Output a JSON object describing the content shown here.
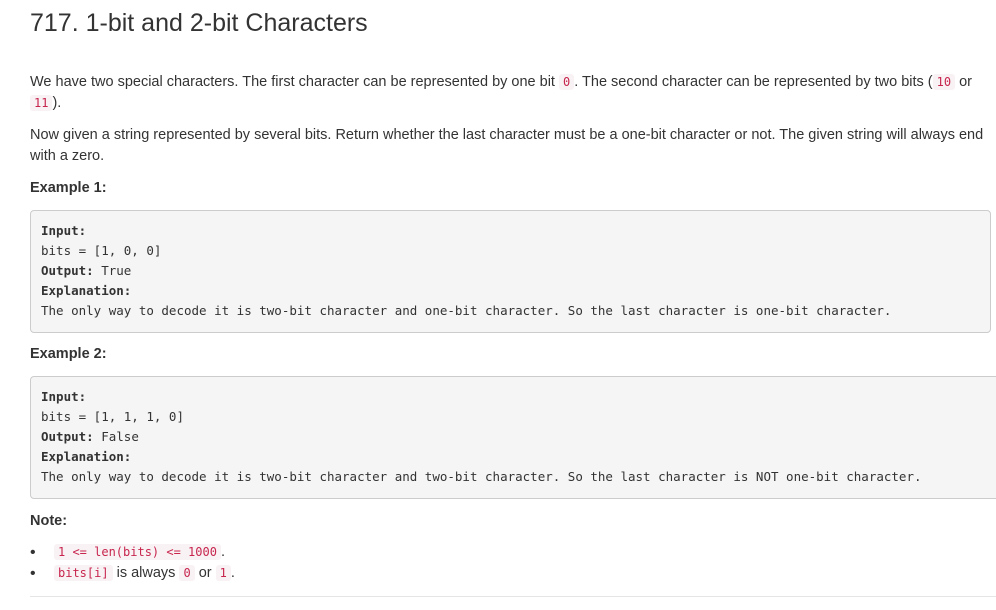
{
  "problem": {
    "title": "717. 1-bit and 2-bit Characters"
  },
  "para1": {
    "t1": "We have two special characters. The first character can be represented by one bit ",
    "c1": "0",
    "t2": ". The second character can be represented by two bits (",
    "c2": "10",
    "t3": " or ",
    "c3": "11",
    "t4": ")."
  },
  "para2": {
    "text": "Now given a string represented by several bits. Return whether the last character must be a one-bit character or not. The given string will always end with a zero."
  },
  "example1": {
    "label": "Example 1:",
    "input_label": "Input:",
    "input_value": "bits = [1, 0, 0]",
    "output_label": "Output:",
    "output_value": " True",
    "explanation_label": "Explanation:",
    "explanation_text": "The only way to decode it is two-bit character and one-bit character. So the last character is one-bit character."
  },
  "example2": {
    "label": "Example 2:",
    "input_label": "Input:",
    "input_value": "bits = [1, 1, 1, 0]",
    "output_label": "Output:",
    "output_value": " False",
    "explanation_label": "Explanation:",
    "explanation_text": "The only way to decode it is two-bit character and two-bit character. So the last character is NOT one-bit character."
  },
  "note": {
    "label": "Note:",
    "bullet": "•",
    "item1": {
      "code": "1 <= len(bits) <= 1000",
      "tail": "."
    },
    "item2": {
      "code1": "bits[i]",
      "t1": " is always ",
      "code2": "0",
      "t2": " or ",
      "code3": "1",
      "t3": "."
    }
  }
}
